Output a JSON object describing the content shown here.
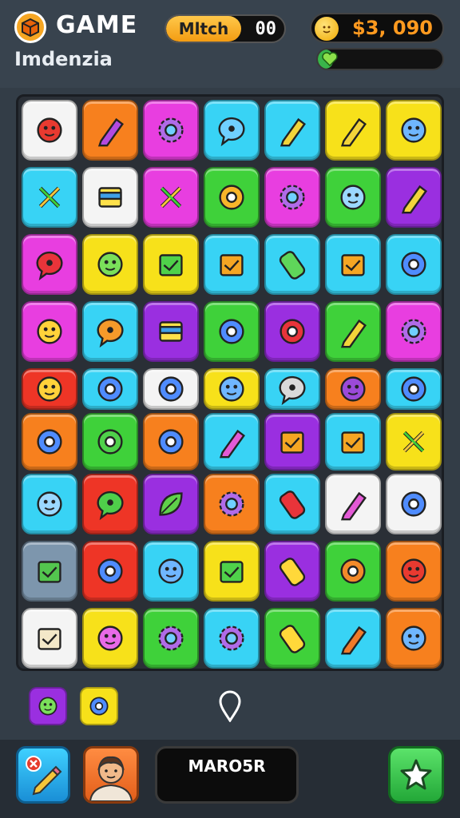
{
  "header": {
    "title": "GAME",
    "subtitle": "Imdenzia",
    "match_label": "Mltch",
    "match_value": "00",
    "coins": "$3, 090",
    "energy_percent": 12
  },
  "board": {
    "rows": 9,
    "cols": 7,
    "tiles": [
      [
        "white",
        "orange",
        "magenta",
        "cyan",
        "cyan",
        "yellow",
        "yellow"
      ],
      [
        "cyan",
        "white",
        "magenta",
        "green",
        "magenta",
        "green",
        "purple"
      ],
      [
        "magenta",
        "yellow",
        "yellow",
        "cyan",
        "cyan",
        "cyan",
        "cyan"
      ],
      [
        "magenta",
        "cyan",
        "purple",
        "green",
        "purple",
        "green",
        "magenta"
      ],
      [
        "red",
        "cyan",
        "white",
        "yellow",
        "cyan",
        "orange",
        "cyan"
      ],
      [
        "orange",
        "green",
        "orange",
        "cyan",
        "purple",
        "cyan",
        "yellow"
      ],
      [
        "cyan",
        "red",
        "purple",
        "orange",
        "cyan",
        "white",
        "white"
      ],
      [
        "slate",
        "red",
        "cyan",
        "yellow",
        "purple",
        "green",
        "orange"
      ],
      [
        "white",
        "yellow",
        "green",
        "cyan",
        "green",
        "cyan",
        "orange"
      ]
    ],
    "icons": [
      [
        "red-blob",
        "purple-pencil",
        "gear-face",
        "leaf-bubble",
        "brush",
        "paint-tube",
        "blue-face"
      ],
      [
        "wrench",
        "yellow-book",
        "green-bat",
        "sun",
        "green-gear",
        "ghost-face",
        "cross-pencils"
      ],
      [
        "red-chat",
        "green-face",
        "green-house",
        "box",
        "green-bottle",
        "picture-frame",
        "compass"
      ],
      [
        "sun-face",
        "orange-chat",
        "brick-cube",
        "blue-orb",
        "no-sign",
        "banana",
        "purple-gear"
      ],
      [
        "yellow-face",
        "blue-target",
        "blue-splat",
        "blue-ghost",
        "gray-chat",
        "purple-face",
        "eye"
      ],
      [
        "flower",
        "swirl",
        "blue-splat",
        "pink-eraser",
        "house",
        "tv",
        "spray-gun"
      ],
      [
        "coin-face",
        "green-chat",
        "green-leaf",
        "purple-gear",
        "red-battery",
        "pink-eraser",
        "button"
      ],
      [
        "check-box",
        "blue-orb",
        "blue-robot",
        "green-house",
        "yellow-battery",
        "orange-bomb",
        "red-germ"
      ],
      [
        "paper",
        "pink-ghost",
        "green-gear",
        "purple-gear",
        "yellow-battery",
        "orange-pencil",
        "blue-bird"
      ]
    ]
  },
  "tray": {
    "items": [
      {
        "color": "#9a2fe0",
        "icon": "green-face"
      },
      {
        "color": "#f7e11a",
        "icon": "blue-target"
      }
    ]
  },
  "footer": {
    "player_name": "MARO5R"
  },
  "colors": {
    "white": "#f4f4f4",
    "orange": "#f7801e",
    "magenta": "#e83ee0",
    "cyan": "#38d3f5",
    "yellow": "#f7e11a",
    "green": "#3fd13a",
    "purple": "#9a2fe0",
    "red": "#ee3526",
    "slate": "#7d96ad"
  }
}
